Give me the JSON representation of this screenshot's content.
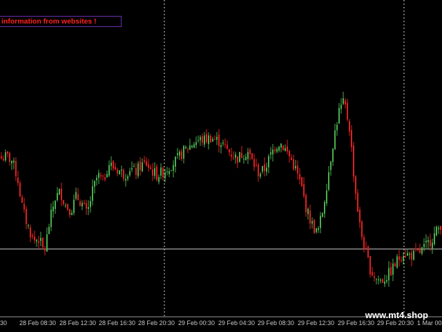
{
  "alert": {
    "text": "information from websites !"
  },
  "watermark": {
    "text": "www.mt4.shop"
  },
  "colors": {
    "background": "#000000",
    "bull": "#4caf50",
    "bear": "#e02020",
    "grid": "#ffffff",
    "axis_text": "#c8c8c8"
  },
  "x_axis": {
    "labels": [
      "28 Feb 08:30",
      "28 Feb 12:30",
      "28 Feb 16:30",
      "28 Feb 20:30",
      "29 Feb 00:30",
      "29 Feb 04:30",
      "29 Feb 08:30",
      "29 Feb 12:30",
      "29 Feb 16:30",
      "29 Feb 20:30",
      "1 Mar 00:30"
    ],
    "partial_left": "30"
  },
  "chart_data": {
    "type": "candlestick",
    "note_series_shape": [
      0.62,
      0.63,
      0.61,
      0.54,
      0.4,
      0.33,
      0.27,
      0.28,
      0.22,
      0.35,
      0.45,
      0.48,
      0.42,
      0.4,
      0.46,
      0.43,
      0.38,
      0.48,
      0.55,
      0.52,
      0.6,
      0.58,
      0.57,
      0.55,
      0.58,
      0.56,
      0.59,
      0.6,
      0.57,
      0.55,
      0.56,
      0.58,
      0.6,
      0.62,
      0.65,
      0.67,
      0.69,
      0.7,
      0.7,
      0.71,
      0.7,
      0.69,
      0.66,
      0.64,
      0.62,
      0.64,
      0.65,
      0.6,
      0.56,
      0.57,
      0.62,
      0.67,
      0.69,
      0.66,
      0.62,
      0.57,
      0.5,
      0.4,
      0.34,
      0.3,
      0.4,
      0.55,
      0.7,
      0.82,
      0.86,
      0.75,
      0.5,
      0.32,
      0.22,
      0.14,
      0.11,
      0.1,
      0.12,
      0.15,
      0.19,
      0.22,
      0.21,
      0.21,
      0.22,
      0.24,
      0.27,
      0.3,
      0.34
    ],
    "horizontal_line": "price level near 0.28 of range",
    "vertical_separators": [
      "28 Feb 20:30",
      "29 Feb 20:30"
    ]
  }
}
